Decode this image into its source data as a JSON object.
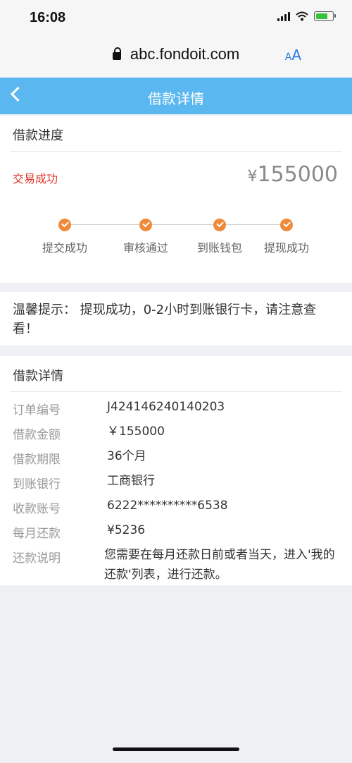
{
  "status_bar": {
    "time": "16:08"
  },
  "browser": {
    "url": "abc.fondoit.com",
    "aa_small": "A",
    "aa_large": "A"
  },
  "header": {
    "title": "借款详情"
  },
  "progress": {
    "section_title": "借款进度",
    "status": "交易成功",
    "amount_symbol": "¥",
    "amount": "155000",
    "steps": [
      "提交成功",
      "审核通过",
      "到账钱包",
      "提现成功"
    ]
  },
  "tip": {
    "text": "温馨提示： 提现成功，0-2小时到账银行卡，请注意查看！"
  },
  "details": {
    "section_title": "借款详情",
    "rows": [
      {
        "label": "订单编号",
        "value": "J424146240140203"
      },
      {
        "label": "借款金额",
        "value": "￥155000"
      },
      {
        "label": "借款期限",
        "value": "36个月"
      },
      {
        "label": "到账银行",
        "value": "工商银行"
      },
      {
        "label": "收款账号",
        "value": "6222**********6538"
      },
      {
        "label": "每月还款",
        "value": "¥5236"
      },
      {
        "label": "还款说明",
        "value": "您需要在每月还款日前或者当天，进入'我的还款'列表，进行还款。"
      }
    ]
  },
  "colors": {
    "header": "#5bb7f0",
    "status_red": "#e0352b",
    "step_orange": "#ee8a3a"
  }
}
